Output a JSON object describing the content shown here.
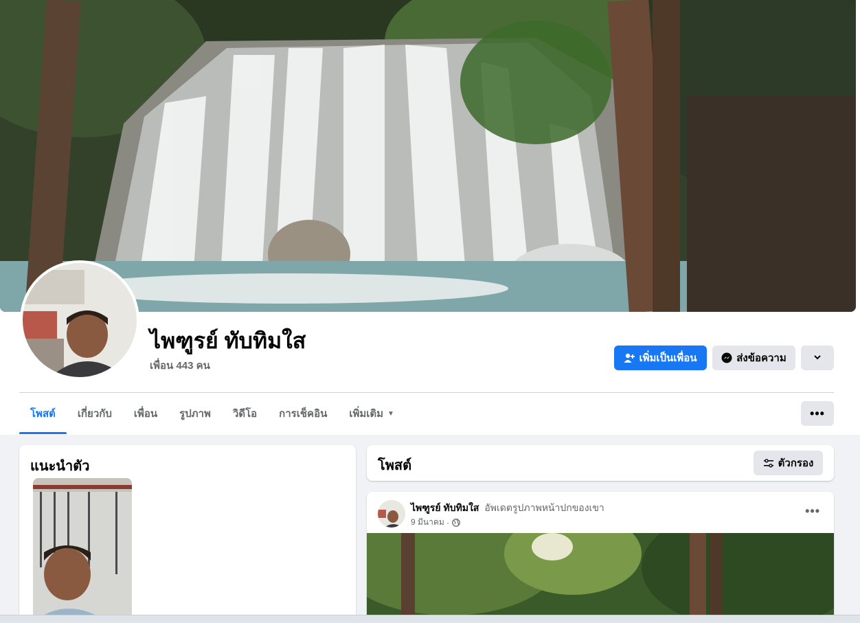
{
  "profile": {
    "name": "ไพฑูรย์ ทับทิมใส",
    "friends_count": "เพื่อน 443 คน"
  },
  "actions": {
    "add_friend": "เพิ่มเป็นเพื่อน",
    "message": "ส่งข้อความ"
  },
  "tabs": [
    {
      "label": "โพสต์",
      "active": true
    },
    {
      "label": "เกี่ยวกับ"
    },
    {
      "label": "เพื่อน"
    },
    {
      "label": "รูปภาพ"
    },
    {
      "label": "วิดีโอ"
    },
    {
      "label": "การเช็คอิน"
    },
    {
      "label": "เพิ่มเติม"
    }
  ],
  "intro": {
    "title": "แนะนำตัว"
  },
  "posts": {
    "title": "โพสต์",
    "filter_label": "ตัวกรอง",
    "items": [
      {
        "author": "ไพฑูรย์ ทับทิมใส",
        "action": "อัพเดตรูปภาพหน้าปกของเขา",
        "date": "9 มีนาคม"
      }
    ]
  },
  "colors": {
    "accent": "#1877f2",
    "background": "#f0f2f5",
    "secondary_button": "#e4e6eb",
    "muted_text": "#65676b"
  },
  "icons": [
    "add-friend-icon",
    "messenger-icon",
    "chevron-down-icon",
    "more-dots-icon",
    "filter-icon",
    "globe-icon",
    "dropdown-caret-icon"
  ]
}
